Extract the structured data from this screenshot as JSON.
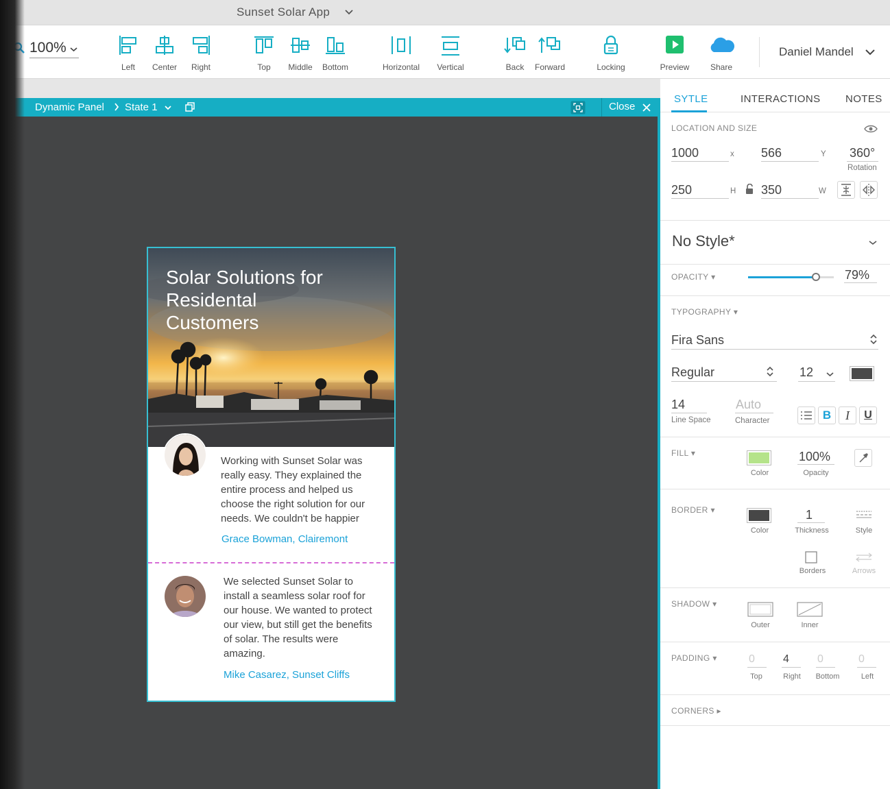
{
  "app": {
    "title": "Sunset Solar App",
    "user_name": "Daniel Mandel"
  },
  "toolbar": {
    "zoom": "100%",
    "buttons": [
      {
        "label": "Left",
        "icon": "align-left-icon"
      },
      {
        "label": "Center",
        "icon": "align-center-icon"
      },
      {
        "label": "Right",
        "icon": "align-right-icon"
      },
      {
        "label": "Top",
        "icon": "align-top-icon"
      },
      {
        "label": "Middle",
        "icon": "align-middle-icon"
      },
      {
        "label": "Bottom",
        "icon": "align-bottom-icon"
      },
      {
        "label": "Horizontal",
        "icon": "distribute-horizontal-icon"
      },
      {
        "label": "Vertical",
        "icon": "distribute-vertical-icon"
      },
      {
        "label": "Back",
        "icon": "send-back-icon"
      },
      {
        "label": "Forward",
        "icon": "bring-forward-icon"
      },
      {
        "label": "Locking",
        "icon": "lock-icon"
      },
      {
        "label": "Preview",
        "icon": "play-icon"
      },
      {
        "label": "Share",
        "icon": "cloud-icon"
      }
    ]
  },
  "breadcrumb": {
    "panel": "Dynamic Panel",
    "state": "State 1",
    "close": "Close"
  },
  "mock": {
    "hero_title": "Solar Solutions for Residental Customers",
    "testimonials": [
      {
        "quote": "Working with Sunset Solar was really easy. They explained the entire process and helped us choose the right solution for our needs. We couldn't be happier",
        "author": "Grace Bowman, Clairemont"
      },
      {
        "quote": "We selected Sunset Solar to install a seamless solar roof for our house. We wanted to protect our view, but still get the benefits of solar. The results were amazing.",
        "author": "Mike Casarez, Sunset Cliffs"
      }
    ]
  },
  "sidebar": {
    "tabs": [
      "SYTLE",
      "INTERACTIONS",
      "NOTES"
    ],
    "location": {
      "title": "LOCATION AND SIZE",
      "x": "1000",
      "x_label": "x",
      "y": "566",
      "y_label": "Y",
      "rotation": "360°",
      "rotation_label": "Rotation",
      "h": "250",
      "h_label": "H",
      "w": "350",
      "w_label": "W"
    },
    "style_name": "No Style*",
    "opacity": {
      "title": "OPACITY",
      "value": "79%",
      "level": 0.79
    },
    "typography": {
      "title": "TYPOGRAPHY",
      "font": "Fira Sans",
      "weight": "Regular",
      "size": "12",
      "line_space": "14",
      "line_space_label": "Line Space",
      "character": "Auto",
      "character_label": "Character",
      "bold": "B",
      "italic": "I",
      "underline": "U",
      "text_color": "#4a4a4a"
    },
    "fill": {
      "title": "FILL",
      "color_label": "Color",
      "color": "#b5e38a",
      "opacity": "100%",
      "opacity_label": "Opacity"
    },
    "border": {
      "title": "BORDER",
      "color_label": "Color",
      "color": "#474747",
      "thickness": "1",
      "thickness_label": "Thickness",
      "style_label": "Style",
      "borders_label": "Borders",
      "arrows_label": "Arrows"
    },
    "shadow": {
      "title": "SHADOW",
      "outer": "Outer",
      "inner": "Inner"
    },
    "padding": {
      "title": "PADDING",
      "top": "0",
      "top_label": "Top",
      "right": "4",
      "right_label": "Right",
      "bottom": "0",
      "bottom_label": "Bottom",
      "left": "0",
      "left_label": "Left"
    },
    "corners": {
      "title": "CORNERS"
    }
  },
  "colors": {
    "accent": "#16aec4",
    "link": "#1ba2d8",
    "canvas": "#444546"
  }
}
